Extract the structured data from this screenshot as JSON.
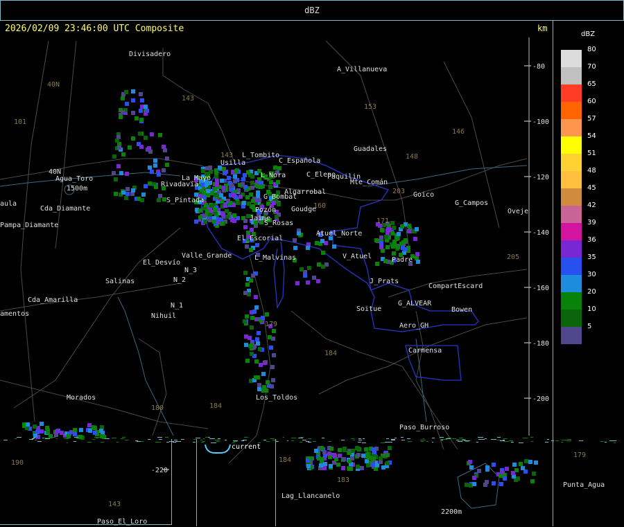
{
  "header": {
    "title": "dBZ"
  },
  "timestamp": "2026/02/09 23:46:00 UTC Composite",
  "unit": "km",
  "legend": {
    "title": "dBZ",
    "entries": [
      {
        "label": "80",
        "color": "#dcdcdc"
      },
      {
        "label": "70",
        "color": "#c0c0c0"
      },
      {
        "label": "65",
        "color": "#ff3c28"
      },
      {
        "label": "60",
        "color": "#ff6400"
      },
      {
        "label": "57",
        "color": "#ff9650"
      },
      {
        "label": "54",
        "color": "#ffff00"
      },
      {
        "label": "51",
        "color": "#ffd232"
      },
      {
        "label": "48",
        "color": "#ffc040"
      },
      {
        "label": "45",
        "color": "#d08c3c"
      },
      {
        "label": "42",
        "color": "#c86496"
      },
      {
        "label": "39",
        "color": "#d214a0"
      },
      {
        "label": "36",
        "color": "#7828d2"
      },
      {
        "label": "35",
        "color": "#2850f0"
      },
      {
        "label": "30",
        "color": "#1e8cdc"
      },
      {
        "label": "20",
        "color": "#088208"
      },
      {
        "label": "10",
        "color": "#0a640a"
      },
      {
        "label": "5",
        "color": "#50468c"
      }
    ]
  },
  "axis_ticks": [
    {
      "label": "-80"
    },
    {
      "label": "-100"
    },
    {
      "label": "-120"
    },
    {
      "label": "-140"
    },
    {
      "label": "-160"
    },
    {
      "label": "-180"
    },
    {
      "label": "-200"
    },
    {
      "label": "-220"
    }
  ],
  "places": [
    "Divisadero",
    "A_Villanueva",
    "Guadales",
    "Usilla",
    "L_Tombito",
    "C_Española",
    "L_Nora",
    "C_Eleno",
    "Paquilin",
    "Mte_Comán",
    "Goico",
    "G_Campos",
    "Oveje",
    "Agua_Toro",
    "Rivadavia",
    "La_Mayo",
    "S_Pintada",
    "Cda_Diamante",
    "Pampa_Diamante",
    "aula",
    "G_Bombal",
    "Algarrobal",
    "Goudge",
    "Pozón",
    "S_Rosas",
    "Atuel_Norte",
    "Jaime",
    "El_Escorial",
    "V_Atuel",
    "Padre",
    "J_Prats",
    "CompartEscard",
    "G_ALVEAR",
    "Bowen",
    "Soitue",
    "Aero_GH",
    "Carmensa",
    "Valle_Grande",
    "El_Desvío",
    "L_Malvinas",
    "Salinas",
    "N_3",
    "N_2",
    "N_1",
    "Nihuil",
    "Cda_Amarilla",
    "amentos",
    "Morados",
    "Los_Toldos",
    "Paso_Burroso",
    "Lag_Llancanelo",
    "Punta_Agua",
    "Paso_El_Loro",
    "40N",
    "1500m",
    "2200m"
  ],
  "routes": [
    "40N",
    "101",
    "143",
    "153",
    "146",
    "148",
    "203",
    "171",
    "160",
    "184",
    "179",
    "180",
    "184",
    "190",
    "143",
    "143",
    "179",
    "183",
    "184",
    "205"
  ],
  "current_label": "current"
}
